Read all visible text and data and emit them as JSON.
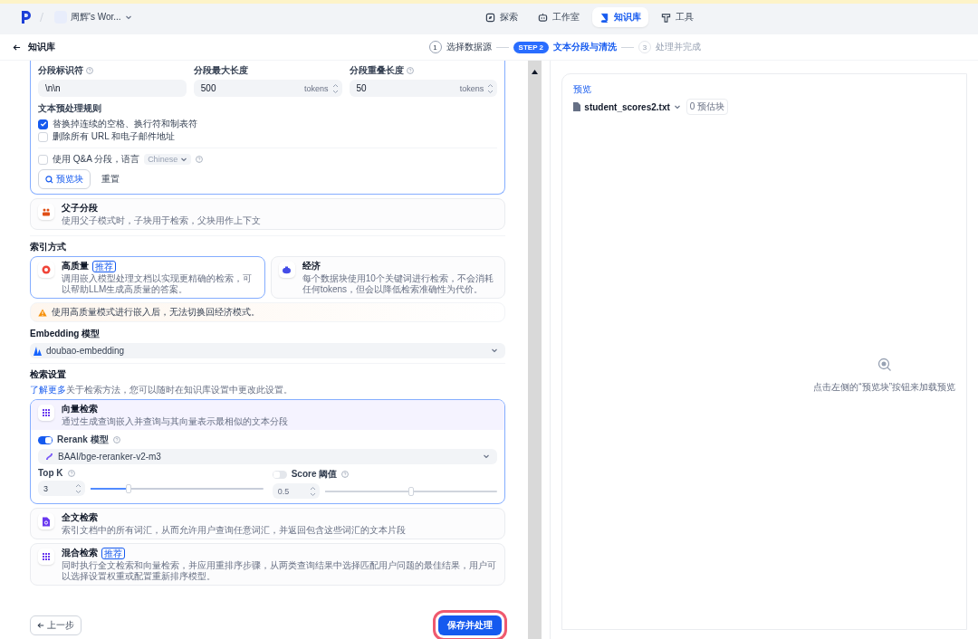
{
  "header": {
    "workspace": "周辉's Wor...",
    "nav": [
      {
        "label": "探索",
        "selected": false
      },
      {
        "label": "工作室",
        "selected": false
      },
      {
        "label": "知识库",
        "selected": true
      },
      {
        "label": "工具",
        "selected": false
      }
    ]
  },
  "page": {
    "title": "知识库"
  },
  "steps": [
    {
      "number": "1",
      "label": "选择数据源",
      "kind": "past"
    },
    {
      "number": "STEP 2",
      "label": "文本分段与清洗",
      "kind": "current"
    },
    {
      "number": "3",
      "label": "处理并完成",
      "kind": "future"
    }
  ],
  "segment": {
    "fields": [
      {
        "label": "分段标识符",
        "help": true,
        "value": "\\n\\n"
      },
      {
        "label": "分段最大长度",
        "value": "500",
        "unit": "tokens"
      },
      {
        "label": "分段重叠长度",
        "help": true,
        "value": "50",
        "unit": "tokens"
      }
    ],
    "rules_title": "文本预处理规则",
    "rules": [
      {
        "label": "替换掉连续的空格、换行符和制表符",
        "checked": true
      },
      {
        "label": "删除所有 URL 和电子邮件地址",
        "checked": false
      }
    ],
    "qa": {
      "label": "使用 Q&A 分段，语言",
      "checked": false,
      "language": "Chinese"
    },
    "preview_button": "预览块",
    "reset_button": "重置"
  },
  "parent_child": {
    "title": "父子分段",
    "description": "使用父子模式时，子块用于检索，父块用作上下文"
  },
  "index_mode": {
    "title": "索引方式",
    "options": [
      {
        "title": "高质量",
        "badge": "推荐",
        "description": "调用嵌入模型处理文档以实现更精确的检索，可以帮助LLM生成高质量的答案。",
        "selected": true
      },
      {
        "title": "经济",
        "description": "每个数据块使用10个关键词进行检索，不会消耗任何tokens，但会以降低检索准确性为代价。",
        "selected": false
      }
    ],
    "warning": "使用高质量模式进行嵌入后，无法切换回经济模式。"
  },
  "embedding": {
    "label": "Embedding 模型",
    "model": "doubao-embedding"
  },
  "retrieval": {
    "title": "检索设置",
    "link": "了解更多",
    "note": "关于检索方法，您可以随时在知识库设置中更改此设置。",
    "methods": [
      {
        "title": "向量检索",
        "description": "通过生成查询嵌入并查询与其向量表示最相似的文本分段",
        "selected": true,
        "rerank": {
          "label": "Rerank 模型",
          "on": true,
          "model": "BAAI/bge-reranker-v2-m3"
        },
        "top_k": {
          "label": "Top K",
          "value": "3",
          "level": 0.22
        },
        "score": {
          "label": "Score 阈值",
          "on": false,
          "value": "0.5",
          "level": 0.5
        }
      },
      {
        "title": "全文检索",
        "description": "索引文档中的所有词汇，从而允许用户查询任意词汇，并返回包含这些词汇的文本片段",
        "selected": false
      },
      {
        "title": "混合检索",
        "badge": "推荐",
        "description": "同时执行全文检索和向量检索，并应用重排序步骤，从两类查询结果中选择匹配用户问题的最佳结果，用户可以选择设置权重或配置重新排序模型。",
        "selected": false
      }
    ]
  },
  "footer": {
    "back_button": "上一步",
    "save_button": {
      "label": "保存并处理",
      "highlighted": true
    }
  },
  "preview": {
    "label": "预览",
    "file": "student_scores2.txt",
    "count": "0 预估块",
    "empty_text": "点击左侧的“预览块”按钮来加载预览"
  }
}
